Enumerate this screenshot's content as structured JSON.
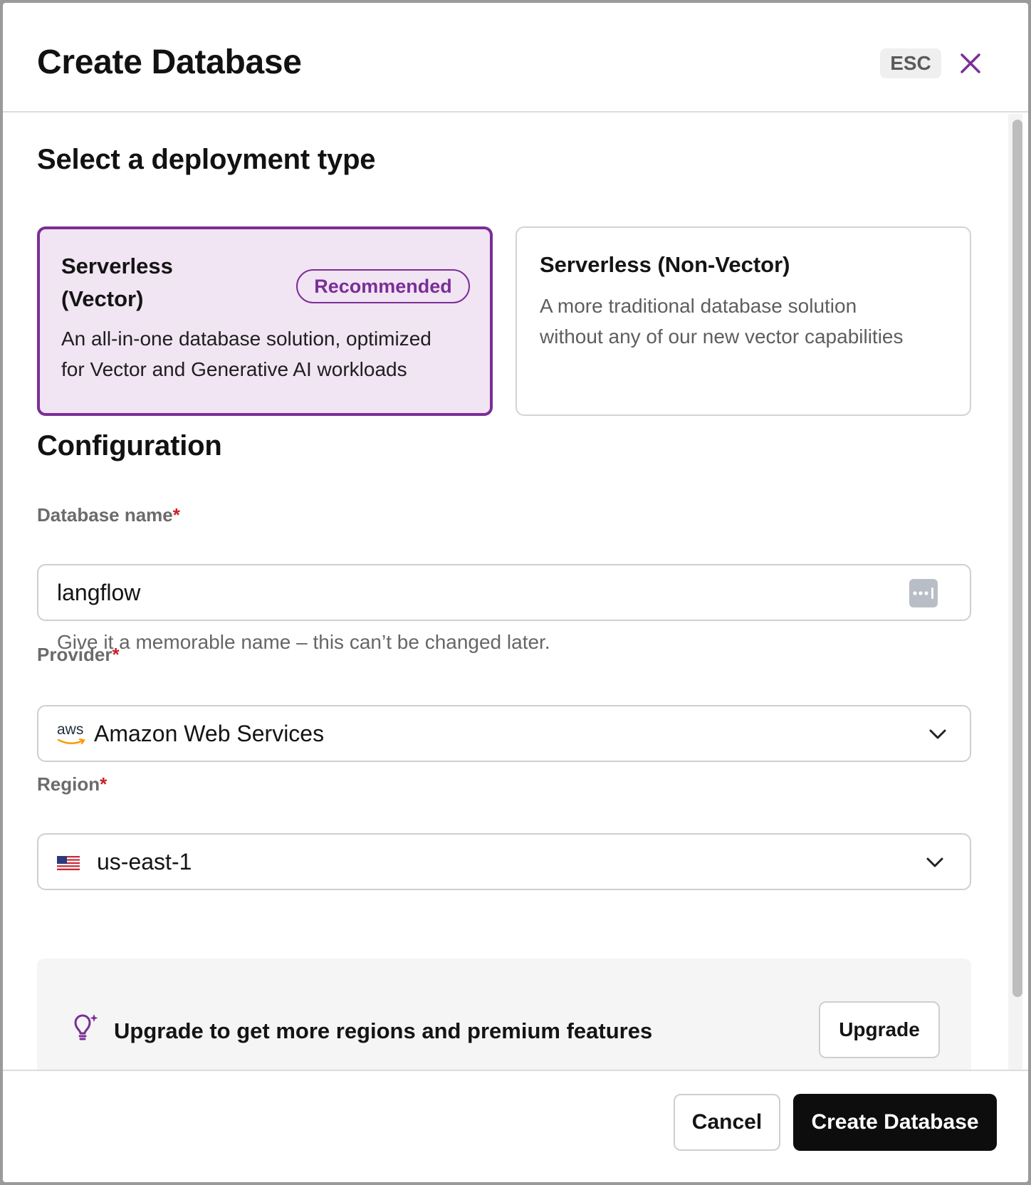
{
  "modal": {
    "title": "Create Database",
    "esc_label": "ESC",
    "accent_color": "#7a2e97"
  },
  "deployment": {
    "heading": "Select a deployment type",
    "options": [
      {
        "title_line1": "Serverless",
        "title_line2": "(Vector)",
        "badge": "Recommended",
        "desc_line1": "An all-in-one database solution, optimized",
        "desc_line2": "for Vector and Generative AI workloads",
        "selected": true
      },
      {
        "title": "Serverless (Non-Vector)",
        "desc_line1": "A more traditional database solution",
        "desc_line2": "without any of our new vector capabilities",
        "selected": false
      }
    ]
  },
  "configuration": {
    "heading": "Configuration",
    "database_name": {
      "label": "Database name",
      "required_mark": "*",
      "value": "langflow",
      "helper": "Give it a memorable name – this can’t be changed later.",
      "icon": "password-manager-icon"
    },
    "provider": {
      "label": "Provider",
      "required_mark": "*",
      "value": "Amazon Web Services",
      "logo_text": "aws",
      "icon": "aws-logo"
    },
    "region": {
      "label": "Region",
      "required_mark": "*",
      "value": "us-east-1",
      "icon": "us-flag-icon"
    }
  },
  "upgrade": {
    "text": "Upgrade to get more regions and premium features",
    "button": "Upgrade",
    "icon": "lightbulb-sparkle-icon"
  },
  "footer": {
    "cancel": "Cancel",
    "create": "Create Database"
  }
}
